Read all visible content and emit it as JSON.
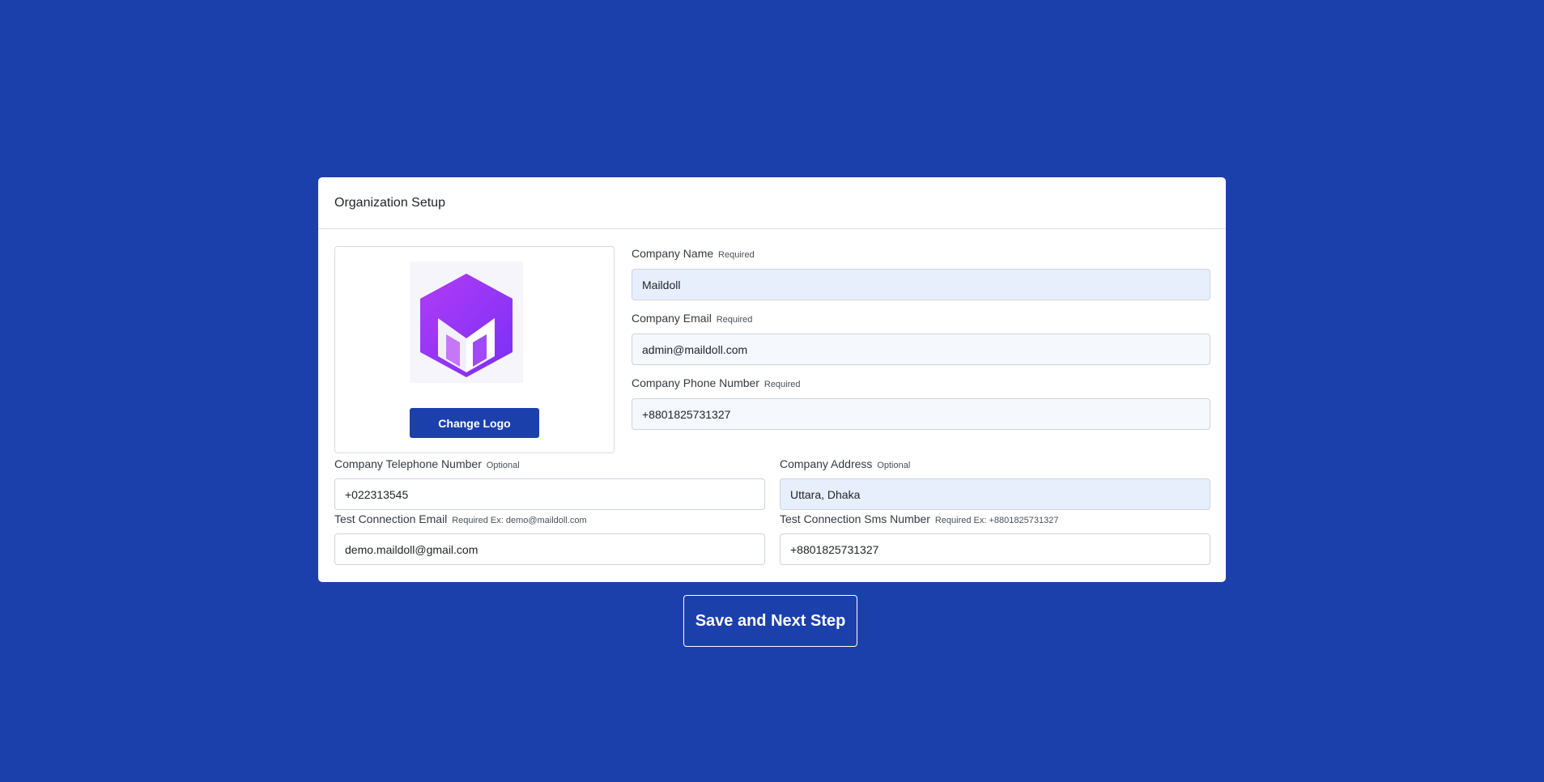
{
  "card": {
    "title": "Organization Setup"
  },
  "logo": {
    "icon": "maildoll-m-cube-logo",
    "change_button_label": "Change Logo",
    "colors": [
      "#7b2ff7",
      "#b03cf5"
    ]
  },
  "fields": {
    "company_name": {
      "label": "Company Name",
      "hint": "Required",
      "value": "Maildoll"
    },
    "company_email": {
      "label": "Company Email",
      "hint": "Required",
      "value": "admin@maildoll.com"
    },
    "company_phone": {
      "label": "Company Phone Number",
      "hint": "Required",
      "value": "+8801825731327"
    },
    "company_telephone": {
      "label": "Company Telephone Number",
      "hint": "Optional",
      "value": "+022313545"
    },
    "company_address": {
      "label": "Company Address",
      "hint": "Optional",
      "value": "Uttara, Dhaka"
    },
    "test_email": {
      "label": "Test Connection Email",
      "hint": "Required Ex: demo@maildoll.com",
      "value": "demo.maildoll@gmail.com"
    },
    "test_sms": {
      "label": "Test Connection Sms Number",
      "hint": "Required Ex: +8801825731327",
      "value": "+8801825731327"
    }
  },
  "actions": {
    "save_next_label": "Save and Next Step"
  },
  "colors": {
    "background": "#1c40ab",
    "primary_button": "#1c40ab",
    "tinted_input": "#e8effc"
  }
}
